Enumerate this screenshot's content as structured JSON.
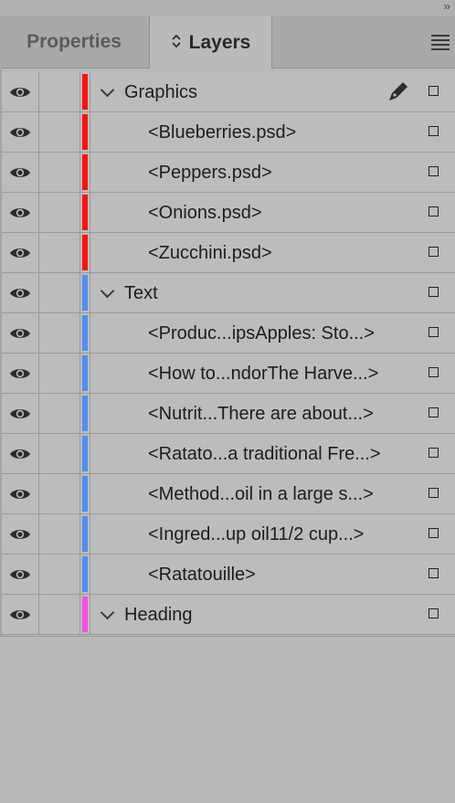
{
  "panel": {
    "collapse_glyph": "››",
    "tabs": [
      {
        "label": "Properties",
        "active": false
      },
      {
        "label": "Layers",
        "active": true,
        "prefix_glyph": "◇"
      }
    ],
    "menu_icon": "hamburger-menu-icon"
  },
  "colors": {
    "graphics": "#ff1111",
    "text": "#4f8ff2",
    "heading": "#ff4fe8"
  },
  "layers": [
    {
      "type": "group",
      "name": "Graphics",
      "color": "#ff1111",
      "visible": true,
      "expanded": true,
      "active_pen": true
    },
    {
      "type": "item",
      "name": "<Blueberries.psd>",
      "color": "#ff1111",
      "visible": true
    },
    {
      "type": "item",
      "name": "<Peppers.psd>",
      "color": "#ff1111",
      "visible": true
    },
    {
      "type": "item",
      "name": "<Onions.psd>",
      "color": "#ff1111",
      "visible": true
    },
    {
      "type": "item",
      "name": "<Zucchini.psd>",
      "color": "#ff1111",
      "visible": true
    },
    {
      "type": "group",
      "name": "Text",
      "color": "#4f8ff2",
      "visible": true,
      "expanded": true
    },
    {
      "type": "item",
      "name": "<Produc...ipsApples: Sto...>",
      "color": "#4f8ff2",
      "visible": true
    },
    {
      "type": "item",
      "name": "<How to...ndorThe Harve...>",
      "color": "#4f8ff2",
      "visible": true
    },
    {
      "type": "item",
      "name": "<Nutrit...There are about...>",
      "color": "#4f8ff2",
      "visible": true
    },
    {
      "type": "item",
      "name": "<Ratato...a traditional Fre...>",
      "color": "#4f8ff2",
      "visible": true
    },
    {
      "type": "item",
      "name": "<Method...oil in a large s...>",
      "color": "#4f8ff2",
      "visible": true
    },
    {
      "type": "item",
      "name": "<Ingred...up oil11/2 cup...>",
      "color": "#4f8ff2",
      "visible": true
    },
    {
      "type": "item",
      "name": "<Ratatouille>",
      "color": "#4f8ff2",
      "visible": true
    },
    {
      "type": "group",
      "name": "Heading",
      "color": "#ff4fe8",
      "visible": true,
      "expanded": true
    }
  ]
}
